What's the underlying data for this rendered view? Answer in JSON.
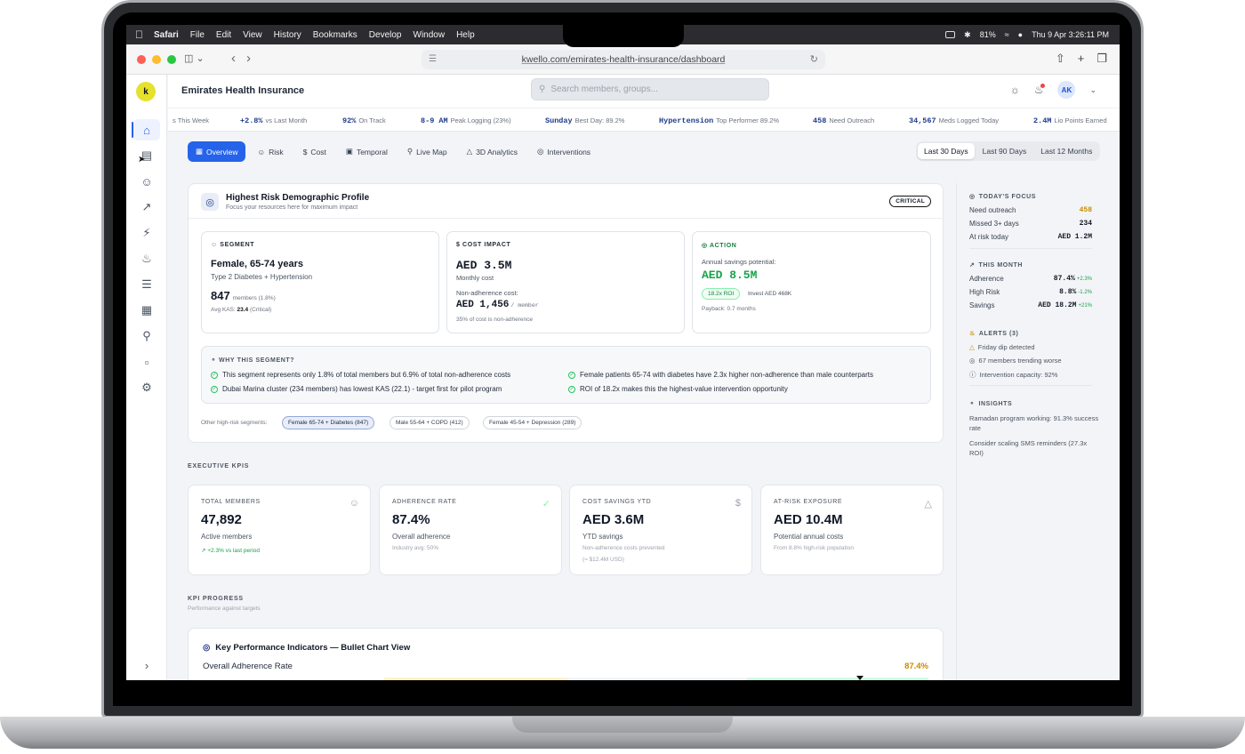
{
  "menubar": {
    "app": "Safari",
    "items": [
      "File",
      "Edit",
      "View",
      "History",
      "Bookmarks",
      "Develop",
      "Window",
      "Help"
    ],
    "battery": "81%",
    "datetime": "Thu 9 Apr  3:26:11 PM"
  },
  "browser": {
    "url": "kwello.com/emirates-health-insurance/dashboard"
  },
  "app": {
    "logo": "k",
    "title": "Emirates Health Insurance",
    "search_placeholder": "Search members, groups...",
    "avatar": "AK"
  },
  "ticker": [
    {
      "val": "",
      "text": "s This Week"
    },
    {
      "val": "+2.8%",
      "text": "vs Last Month"
    },
    {
      "val": "92%",
      "text": "On Track"
    },
    {
      "val": "8-9 AM",
      "text": "Peak Logging (23%)"
    },
    {
      "val": "Sunday",
      "text": "Best Day: 89.2%"
    },
    {
      "val": "Hypertension",
      "text": "Top Performer 89.2%"
    },
    {
      "val": "458",
      "text": "Need Outreach"
    },
    {
      "val": "34,567",
      "text": "Meds Logged Today"
    },
    {
      "val": "2.4M",
      "text": "Lio Points Earned"
    }
  ],
  "tabs": [
    "Overview",
    "Risk",
    "Cost",
    "Temporal",
    "Live Map",
    "3D Analytics",
    "Interventions"
  ],
  "ranges": [
    "Last 30 Days",
    "Last 90 Days",
    "Last 12 Months"
  ],
  "risk_profile": {
    "title": "Highest Risk Demographic Profile",
    "subtitle": "Focus your resources here for maximum impact",
    "badge": "CRITICAL",
    "segment": {
      "label": "SEGMENT",
      "name": "Female, 65-74 years",
      "conditions": "Type 2 Diabetes + Hypertension",
      "members": "847",
      "members_suffix": "members (1.8%)",
      "kas_prefix": "Avg KAS:",
      "kas_value": "23.4",
      "kas_suffix": "(Critical)"
    },
    "cost": {
      "label": "COST IMPACT",
      "monthly": "AED 3.5M",
      "monthly_label": "Monthly cost",
      "nonadh_label": "Non-adherence cost:",
      "per_member": "AED 1,456",
      "per_member_suffix": "/ member",
      "note": "35% of cost is non-adherence"
    },
    "action": {
      "label": "ACTION",
      "savings_label": "Annual savings potential:",
      "savings": "AED 8.5M",
      "roi": "18.2x ROI",
      "invest": "Invest AED 468K",
      "payback": "Payback: 0.7 months"
    },
    "why": {
      "label": "WHY THIS SEGMENT?",
      "items": [
        "This segment represents only 1.8% of total members but 6.9% of total non-adherence costs",
        "Female patients 65-74 with diabetes have 2.3x higher non-adherence than male counterparts",
        "Dubai Marina cluster (234 members) has lowest KAS (22.1) - target first for pilot program",
        "ROI of 18.2x makes this the highest-value intervention opportunity"
      ]
    },
    "other_label": "Other high-risk segments:",
    "other": [
      "Female 65-74 + Diabetes (847)",
      "Male 55-64 + COPD (412)",
      "Female 45-54 + Depression (289)"
    ]
  },
  "kpis": {
    "section": "EXECUTIVE KPIS",
    "cards": [
      {
        "label": "TOTAL MEMBERS",
        "value": "47,892",
        "desc": "Active members",
        "note": "+2.3% vs last period",
        "note2": ""
      },
      {
        "label": "ADHERENCE RATE",
        "value": "87.4%",
        "desc": "Overall adherence",
        "note": "Industry avg: 50%",
        "note2": ""
      },
      {
        "label": "COST SAVINGS YTD",
        "value": "AED 3.6M",
        "desc": "YTD savings",
        "note": "Non-adherence costs prevented",
        "note2": "(≈ $12.4M USD)"
      },
      {
        "label": "AT-RISK EXPOSURE",
        "value": "AED 10.4M",
        "desc": "Potential annual costs",
        "note": "From 8.8% high-risk population",
        "note2": ""
      }
    ]
  },
  "progress": {
    "section": "KPI PROGRESS",
    "subtitle": "Performance against targets",
    "card_title": "Key Performance Indicators — Bullet Chart View",
    "row_label": "Overall Adherence Rate",
    "row_value": "87.4%",
    "row_fraction": 0.874
  },
  "focus": {
    "today_label": "TODAY'S FOCUS",
    "today": [
      {
        "k": "Need outreach",
        "v": "458"
      },
      {
        "k": "Missed 3+ days",
        "v": "234"
      },
      {
        "k": "At risk today",
        "v": "AED 1.2M"
      }
    ],
    "month_label": "THIS MONTH",
    "month": [
      {
        "k": "Adherence",
        "v": "87.4%",
        "d": "+2.3%"
      },
      {
        "k": "High Risk",
        "v": "8.8%",
        "d": "-1.2%"
      },
      {
        "k": "Savings",
        "v": "AED 18.2M",
        "d": "+21%"
      }
    ],
    "alerts_label": "ALERTS (3)",
    "alerts": [
      "Friday dip detected",
      "67 members trending worse",
      "Intervention capacity: 92%"
    ],
    "insights_label": "INSIGHTS",
    "insights": [
      "Ramadan program working: 91.3% success rate",
      "Consider scaling SMS reminders (27.3x ROI)"
    ]
  },
  "colors": {
    "accent": "#2563eb",
    "success": "#16a34a",
    "warning": "#ca8a04",
    "logo": "#e6e12c"
  }
}
